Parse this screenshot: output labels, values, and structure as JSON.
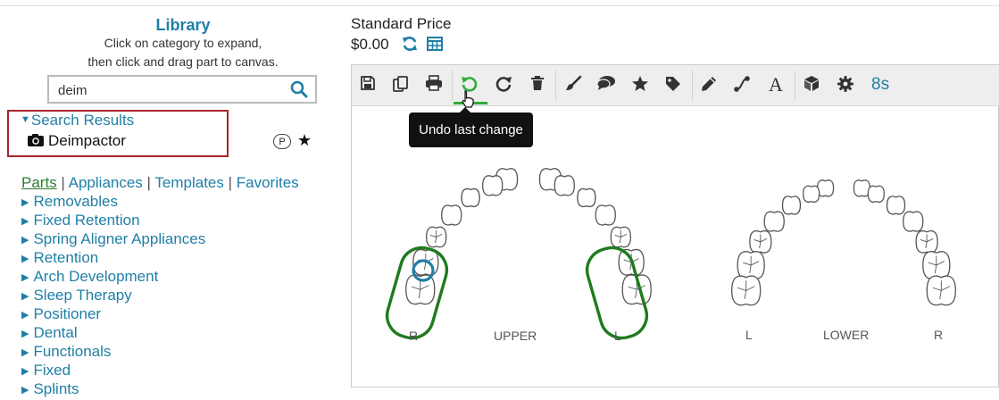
{
  "library": {
    "title": "Library",
    "instruction_line1": "Click on category to expand,",
    "instruction_line2": "then click and drag part to canvas.",
    "search": {
      "value": "deim",
      "icon": "search-icon"
    },
    "results": {
      "header": "Search Results",
      "items": [
        {
          "label": "Deimpactor",
          "icon": "camera-icon",
          "badge": "P",
          "favorite_icon": "star-icon"
        }
      ]
    },
    "tabs": [
      {
        "label": "Parts",
        "active": true
      },
      {
        "label": "Appliances"
      },
      {
        "label": "Templates"
      },
      {
        "label": "Favorites"
      }
    ],
    "tab_separator": "|",
    "categories": [
      "Removables",
      "Fixed Retention",
      "Spring Aligner Appliances",
      "Retention",
      "Arch Development",
      "Sleep Therapy",
      "Positioner",
      "Dental",
      "Functionals",
      "Fixed",
      "Splints"
    ]
  },
  "pricing": {
    "label": "Standard Price",
    "value": "$0.00",
    "icons": [
      "refresh-icon",
      "table-icon"
    ]
  },
  "toolbar": {
    "buttons": [
      {
        "name": "save-icon"
      },
      {
        "name": "copy-icon"
      },
      {
        "name": "print-icon"
      },
      {
        "name": "undo-icon",
        "active": true
      },
      {
        "name": "redo-icon"
      },
      {
        "name": "trash-icon"
      },
      {
        "name": "brush-icon"
      },
      {
        "name": "comment-icon"
      },
      {
        "name": "star-icon"
      },
      {
        "name": "tag-icon"
      },
      {
        "name": "pencil-icon"
      },
      {
        "name": "connector-icon"
      },
      {
        "name": "text-icon",
        "label": "A"
      },
      {
        "name": "cube-icon"
      },
      {
        "name": "gear-icon"
      }
    ],
    "timer": "8s",
    "tooltip": "Undo last change",
    "accent_color": "#2eaa3a"
  },
  "canvas": {
    "upper": {
      "label": "UPPER",
      "left": "R",
      "right": "L"
    },
    "lower": {
      "label": "LOWER",
      "left": "L",
      "right": "R"
    },
    "highlight_color": "#1e7b1e",
    "marker_color": "#1f7fa6"
  }
}
